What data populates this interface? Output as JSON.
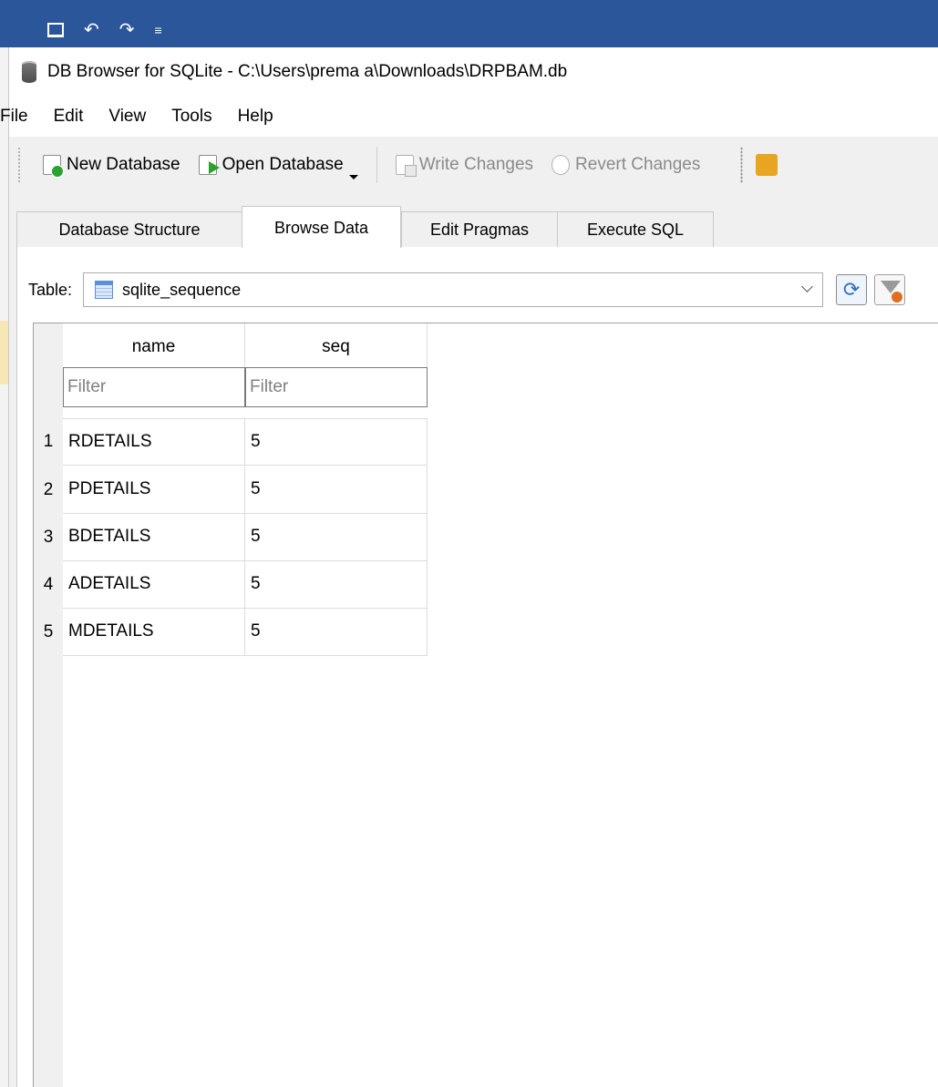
{
  "window": {
    "title": "DB Browser for SQLite - C:\\Users\\prema a\\Downloads\\DRPBAM.db"
  },
  "menu": [
    "File",
    "Edit",
    "View",
    "Tools",
    "Help"
  ],
  "toolbar": {
    "new_database": "New Database",
    "open_database": "Open Database",
    "write_changes": "Write Changes",
    "revert_changes": "Revert Changes"
  },
  "tabs": [
    "Database Structure",
    "Browse Data",
    "Edit Pragmas",
    "Execute SQL"
  ],
  "active_tab": "Browse Data",
  "browse": {
    "table_label": "Table:",
    "selected_table": "sqlite_sequence",
    "columns": [
      "name",
      "seq"
    ],
    "filter_placeholders": [
      "Filter",
      "Filter"
    ],
    "rows": [
      {
        "num": "1",
        "name": "RDETAILS",
        "seq": "5"
      },
      {
        "num": "2",
        "name": "PDETAILS",
        "seq": "5"
      },
      {
        "num": "3",
        "name": "BDETAILS",
        "seq": "5"
      },
      {
        "num": "4",
        "name": "ADETAILS",
        "seq": "5"
      },
      {
        "num": "5",
        "name": "MDETAILS",
        "seq": "5"
      }
    ]
  },
  "icons": {
    "app": "database-icon",
    "table": "table-icon",
    "refresh": "refresh-icon",
    "filter": "clear-filter-icon"
  }
}
